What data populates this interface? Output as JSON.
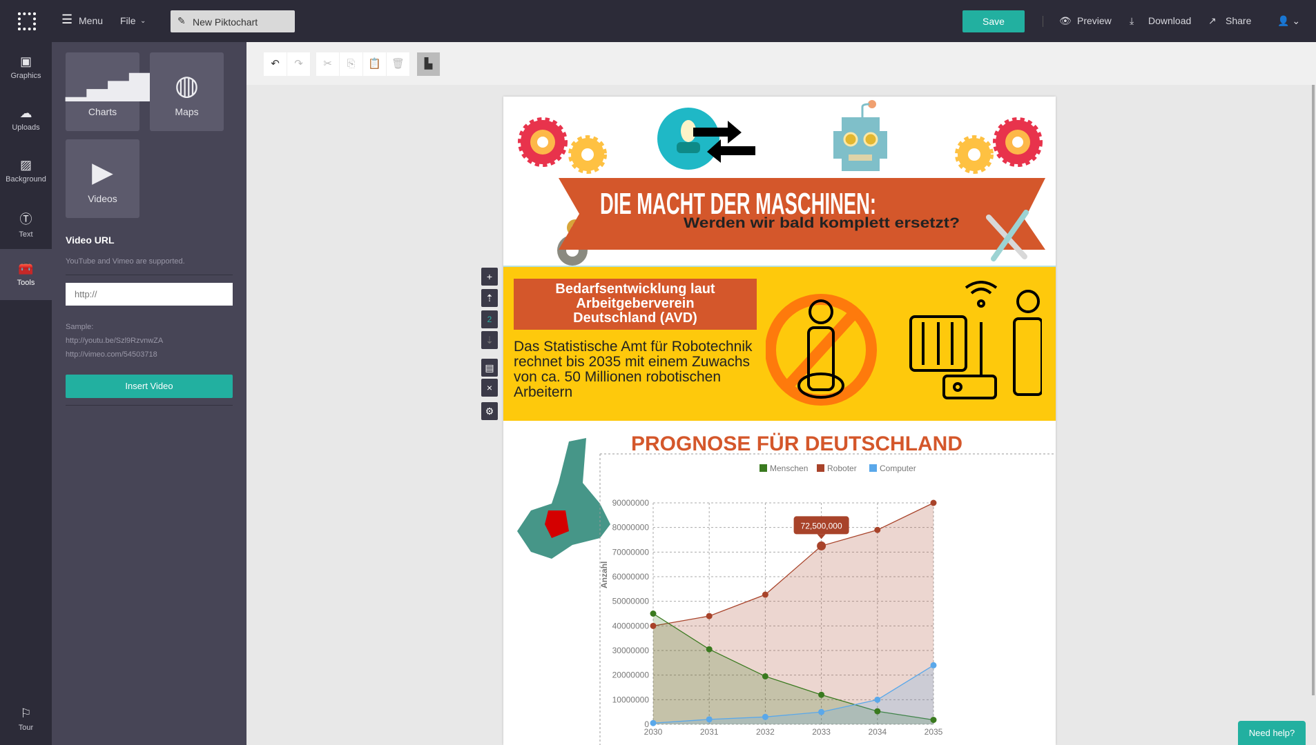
{
  "topbar": {
    "menu": "Menu",
    "file": "File",
    "doc_title": "New Piktochart",
    "save": "Save",
    "preview": "Preview",
    "download": "Download",
    "share": "Share"
  },
  "rail": {
    "items": [
      {
        "label": "Graphics",
        "icon": "image-icon"
      },
      {
        "label": "Uploads",
        "icon": "cloud-upload-icon"
      },
      {
        "label": "Background",
        "icon": "hatch-icon"
      },
      {
        "label": "Text",
        "icon": "text-icon"
      },
      {
        "label": "Tools",
        "icon": "toolbox-icon"
      }
    ],
    "tour": "Tour",
    "active": "Tools"
  },
  "panel": {
    "tiles": [
      {
        "label": "Charts",
        "icon": "bar-chart-icon"
      },
      {
        "label": "Maps",
        "icon": "globe-icon"
      },
      {
        "label": "Videos",
        "icon": "play-icon"
      }
    ],
    "video_url_label": "Video URL",
    "video_note": "YouTube and Vimeo are supported.",
    "input_placeholder": "http://",
    "sample_label": "Sample:",
    "sample_1": "http://youtu.be/Szl9RzvnwZA",
    "sample_2": "http://vimeo.com/54503718",
    "insert": "Insert Video"
  },
  "block_controls": {
    "block_number": "2"
  },
  "infographic": {
    "title": "DIE MACHT DER MASCHINEN:",
    "subtitle": "Werden wir bald komplett ersetzt?",
    "box_title": "Bedarfsentwicklung laut Arbeitgeberverein Deutschland (AVD)",
    "body": "Das Statistische Amt für Robotechnik rechnet bis 2035 mit einem Zuwachs von ca. 50 Millionen robotischen Arbeitern",
    "chart_title": "PROGNOSE FÜR DEUTSCHLAND"
  },
  "help": "Need help?",
  "colors": {
    "accent": "#22b0a0",
    "dark": "#2c2b38",
    "orange": "#d4572b",
    "yellow": "#fec90c"
  },
  "chart_data": {
    "type": "area",
    "x": [
      2030,
      2031,
      2032,
      2033,
      2034,
      2035
    ],
    "ylabel": "Anzahl",
    "ylim": [
      0,
      90000000
    ],
    "yticks": [
      "0",
      "10000000",
      "20000000",
      "30000000",
      "40000000",
      "50000000",
      "60000000",
      "70000000",
      "80000000",
      "90000000"
    ],
    "legend": "top",
    "grid": true,
    "tooltip": "72,500,000",
    "series": [
      {
        "name": "Menschen",
        "color": "#3a7a1f",
        "values": [
          45000000,
          30500000,
          19500000,
          12000000,
          5300000,
          1800000
        ]
      },
      {
        "name": "Roboter",
        "color": "#a8432a",
        "values": [
          40000000,
          44000000,
          52700000,
          72500000,
          79000000,
          90000000
        ]
      },
      {
        "name": "Computer",
        "color": "#5aa8ea",
        "values": [
          500000,
          2000000,
          3000000,
          5000000,
          10000000,
          24000000
        ]
      }
    ]
  }
}
